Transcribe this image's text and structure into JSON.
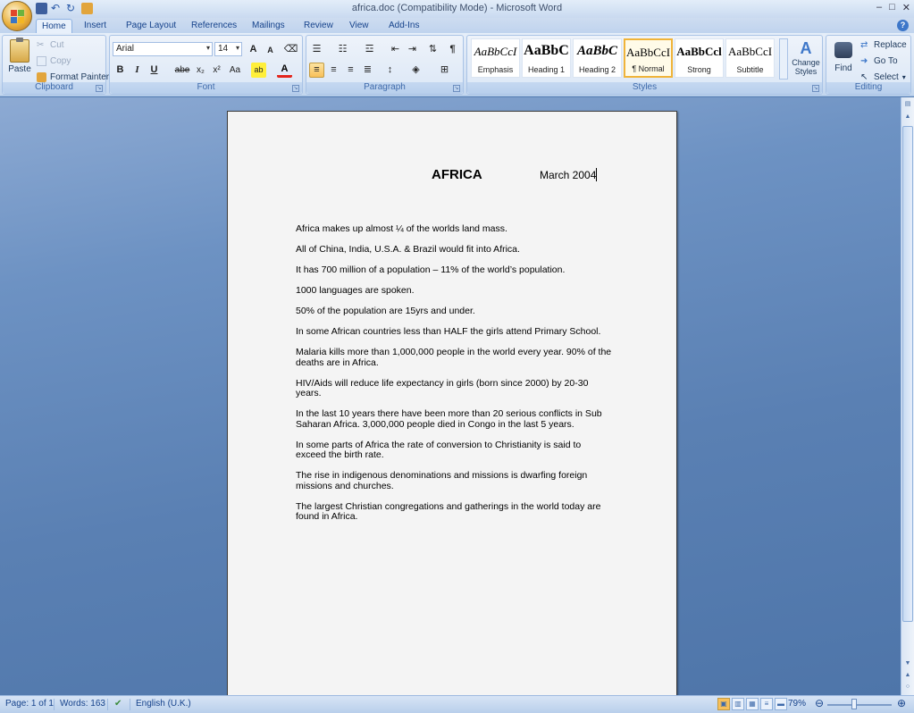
{
  "window": {
    "title": "africa.doc (Compatibility Mode) - Microsoft Word",
    "controls": [
      "–",
      "□",
      "✕"
    ]
  },
  "tabs": [
    "Home",
    "Insert",
    "Page Layout",
    "References",
    "Mailings",
    "Review",
    "View",
    "Add-Ins"
  ],
  "active_tab": "Home",
  "clipboard": {
    "paste": "Paste",
    "cut": "Cut",
    "copy": "Copy",
    "format_painter": "Format Painter",
    "label": "Clipboard"
  },
  "font": {
    "name": "Arial",
    "size": "14",
    "label": "Font",
    "buttons": {
      "bold": "B",
      "italic": "I",
      "underline": "U",
      "strike": "abe",
      "subscript": "x₂",
      "superscript": "x²",
      "case": "Aa",
      "grow": "A",
      "shrink": "A"
    }
  },
  "paragraph": {
    "label": "Paragraph"
  },
  "styles": {
    "label": "Styles",
    "items": [
      {
        "sample": "AaBbCcI",
        "name": "Emphasis"
      },
      {
        "sample": "AaBbC",
        "name": "Heading 1"
      },
      {
        "sample": "AaBbC",
        "name": "Heading 2"
      },
      {
        "sample": "AaBbCcI",
        "name": "¶ Normal"
      },
      {
        "sample": "AaBbCcl",
        "name": "Strong"
      },
      {
        "sample": "AaBbCcI",
        "name": "Subtitle"
      }
    ],
    "change_styles": "Change Styles"
  },
  "editing": {
    "label": "Editing",
    "find": "Find",
    "replace": "Replace",
    "goto": "Go To",
    "select": "Select"
  },
  "document": {
    "title": "AFRICA",
    "date": "March 2004",
    "paragraphs": [
      "Africa makes up almost ¼ of the worlds land mass.",
      "All of China, India, U.S.A. & Brazil would fit into Africa.",
      "It has 700 million of a population – 11% of the world’s population.",
      "1000 languages are spoken.",
      "50% of the population are 15yrs and under.",
      "In some African countries less than HALF the girls attend Primary School.",
      "Malaria kills more than 1,000,000 people in the world every year. 90% of the deaths are in Africa.",
      "HIV/Aids will reduce life expectancy in girls (born since 2000) by 20-30 years.",
      "In the last 10 years there have been more than 20 serious conflicts in Sub Saharan Africa. 3,000,000 people died in Congo in the last 5 years.",
      "In some parts of Africa the rate of conversion to Christianity is said to exceed the birth rate.",
      "The rise in indigenous denominations and missions is dwarfing foreign missions and churches.",
      "The largest Christian congregations and gatherings in the world today are found in Africa."
    ]
  },
  "status": {
    "page": "Page: 1 of 1",
    "words": "Words: 163",
    "language": "English (U.K.)",
    "zoom": "79%"
  },
  "colors": {
    "accent": "#15428b",
    "selected_style": "#f0b43a",
    "background": "#5b82b4"
  }
}
